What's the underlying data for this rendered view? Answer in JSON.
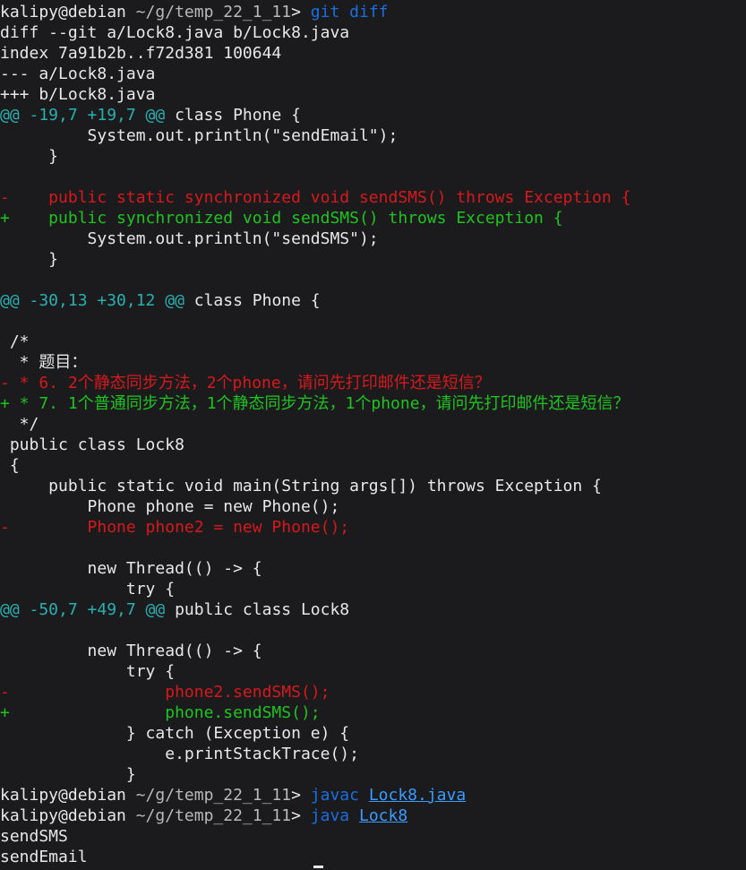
{
  "lines": [
    [
      {
        "t": "kalipy@debian ",
        "c": "default"
      },
      {
        "t": "~/g/temp_22_1_11",
        "c": "dim"
      },
      {
        "t": "> ",
        "c": "default"
      },
      {
        "t": "git diff",
        "c": "blue"
      }
    ],
    [
      {
        "t": "diff --git a/Lock8.java b/Lock8.java",
        "c": "default"
      }
    ],
    [
      {
        "t": "index 7a91b2b..f72d381 100644",
        "c": "default"
      }
    ],
    [
      {
        "t": "--- a/Lock8.java",
        "c": "default"
      }
    ],
    [
      {
        "t": "+++ b/Lock8.java",
        "c": "default"
      }
    ],
    [
      {
        "t": "@@ -19,7 +19,7 @@",
        "c": "teal"
      },
      {
        "t": " class Phone {",
        "c": "default"
      }
    ],
    [
      {
        "t": "         System.out.println(\"sendEmail\");",
        "c": "default"
      }
    ],
    [
      {
        "t": "     }",
        "c": "default"
      }
    ],
    [
      {
        "t": "",
        "c": "default"
      }
    ],
    [
      {
        "t": "-    public static synchronized void sendSMS() throws Exception {",
        "c": "red"
      }
    ],
    [
      {
        "t": "+    public synchronized void sendSMS() throws Exception {",
        "c": "green"
      }
    ],
    [
      {
        "t": "         System.out.println(\"sendSMS\");",
        "c": "default"
      }
    ],
    [
      {
        "t": "     }",
        "c": "default"
      }
    ],
    [
      {
        "t": "",
        "c": "default"
      }
    ],
    [
      {
        "t": "@@ -30,13 +30,12 @@",
        "c": "teal"
      },
      {
        "t": " class Phone {",
        "c": "default"
      }
    ],
    [
      {
        "t": "",
        "c": "default"
      }
    ],
    [
      {
        "t": " /*",
        "c": "default"
      }
    ],
    [
      {
        "t": "  * 题目：",
        "c": "default"
      }
    ],
    [
      {
        "t": "- * 6. 2个静态同步方法，2个phone，请问先打印邮件还是短信？",
        "c": "red"
      }
    ],
    [
      {
        "t": "+ * 7. 1个普通同步方法，1个静态同步方法，1个phone，请问先打印邮件还是短信？",
        "c": "green"
      }
    ],
    [
      {
        "t": "  */",
        "c": "default"
      }
    ],
    [
      {
        "t": " public class Lock8",
        "c": "default"
      }
    ],
    [
      {
        "t": " {",
        "c": "default"
      }
    ],
    [
      {
        "t": "     public static void main(String args[]) throws Exception {",
        "c": "default"
      }
    ],
    [
      {
        "t": "         Phone phone = new Phone();",
        "c": "default"
      }
    ],
    [
      {
        "t": "-        Phone phone2 = new Phone();",
        "c": "red"
      }
    ],
    [
      {
        "t": "",
        "c": "default"
      }
    ],
    [
      {
        "t": "         new Thread(() -> {",
        "c": "default"
      }
    ],
    [
      {
        "t": "             try {",
        "c": "default"
      }
    ],
    [
      {
        "t": "@@ -50,7 +49,7 @@",
        "c": "teal"
      },
      {
        "t": " public class Lock8",
        "c": "default"
      }
    ],
    [
      {
        "t": "",
        "c": "default"
      }
    ],
    [
      {
        "t": "         new Thread(() -> {",
        "c": "default"
      }
    ],
    [
      {
        "t": "             try {",
        "c": "default"
      }
    ],
    [
      {
        "t": "-                phone2.sendSMS();",
        "c": "red"
      }
    ],
    [
      {
        "t": "+                phone.sendSMS();",
        "c": "green"
      }
    ],
    [
      {
        "t": "             } catch (Exception e) {",
        "c": "default"
      }
    ],
    [
      {
        "t": "                 e.printStackTrace();",
        "c": "default"
      }
    ],
    [
      {
        "t": "             }",
        "c": "default"
      }
    ],
    [
      {
        "t": "kalipy@debian ",
        "c": "default"
      },
      {
        "t": "~/g/temp_22_1_11",
        "c": "dim"
      },
      {
        "t": "> ",
        "c": "default"
      },
      {
        "t": "javac ",
        "c": "blue"
      },
      {
        "t": "Lock8.java",
        "c": "link"
      }
    ],
    [
      {
        "t": "kalipy@debian ",
        "c": "default"
      },
      {
        "t": "~/g/temp_22_1_11",
        "c": "dim"
      },
      {
        "t": "> ",
        "c": "default"
      },
      {
        "t": "java ",
        "c": "blue"
      },
      {
        "t": "Lock8",
        "c": "link"
      }
    ],
    [
      {
        "t": "sendSMS",
        "c": "default"
      }
    ],
    [
      {
        "t": "sendEmail",
        "c": "default"
      }
    ]
  ],
  "colors": {
    "background": "#1b1b1d",
    "default": "#e8e8e8",
    "removed": "#d7191c",
    "added": "#1fc41f",
    "hunk": "#2ab0b0",
    "command": "#1a6fe0",
    "link": "#3b9bff"
  }
}
